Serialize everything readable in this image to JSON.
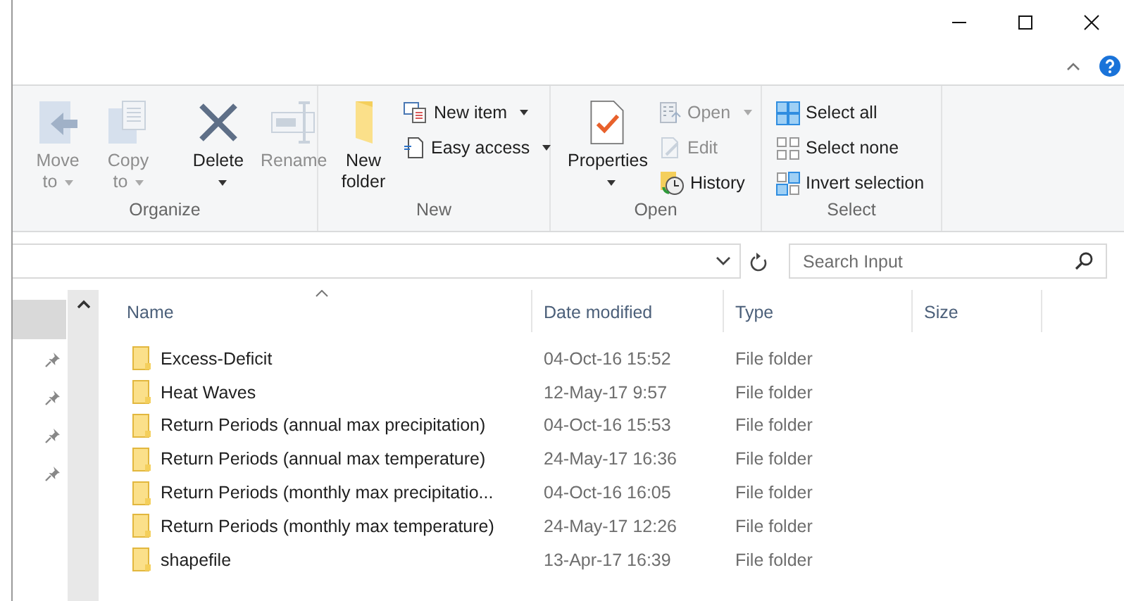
{
  "ribbon": {
    "groups": [
      {
        "label": "Organize",
        "items": [
          {
            "kind": "large",
            "label": "Move to",
            "disabled": true,
            "dropdown": true
          },
          {
            "kind": "large",
            "label": "Copy to",
            "disabled": true,
            "dropdown": true
          },
          {
            "kind": "large",
            "label": "Delete",
            "disabled": false,
            "dropdown": true
          },
          {
            "kind": "large",
            "label": "Rename",
            "disabled": true,
            "dropdown": false
          }
        ]
      },
      {
        "label": "New",
        "items": [
          {
            "kind": "large",
            "label": "New folder",
            "disabled": false,
            "dropdown": false
          },
          {
            "kind": "small",
            "label": "New item",
            "disabled": false,
            "dropdown": true
          },
          {
            "kind": "small",
            "label": "Easy access",
            "disabled": false,
            "dropdown": true
          }
        ]
      },
      {
        "label": "Open",
        "items": [
          {
            "kind": "large",
            "label": "Properties",
            "disabled": false,
            "dropdown": true
          },
          {
            "kind": "small",
            "label": "Open",
            "disabled": true,
            "dropdown": true
          },
          {
            "kind": "small",
            "label": "Edit",
            "disabled": true,
            "dropdown": false
          },
          {
            "kind": "small",
            "label": "History",
            "disabled": false,
            "dropdown": false
          }
        ]
      },
      {
        "label": "Select",
        "items": [
          {
            "kind": "small",
            "label": "Select all",
            "disabled": false,
            "dropdown": false
          },
          {
            "kind": "small",
            "label": "Select none",
            "disabled": false,
            "dropdown": false
          },
          {
            "kind": "small",
            "label": "Invert selection",
            "disabled": false,
            "dropdown": false
          }
        ]
      }
    ]
  },
  "search": {
    "placeholder": "Search Input"
  },
  "nav_pane": {
    "items": [
      {
        "selected": true,
        "pinned": false
      },
      {
        "selected": false,
        "pinned": true
      },
      {
        "selected": false,
        "pinned": true
      },
      {
        "selected": false,
        "pinned": true
      },
      {
        "selected": false,
        "pinned": true
      }
    ]
  },
  "table": {
    "columns": [
      {
        "label": "Name",
        "sorted": true
      },
      {
        "label": "Date modified",
        "sorted": false
      },
      {
        "label": "Type",
        "sorted": false
      },
      {
        "label": "Size",
        "sorted": false
      }
    ],
    "rows": [
      {
        "name": "Excess-Deficit",
        "date": "04-Oct-16 15:52",
        "type": "File folder"
      },
      {
        "name": "Heat Waves",
        "date": "12-May-17 9:57",
        "type": "File folder"
      },
      {
        "name": "Return Periods (annual max precipitation)",
        "date": "04-Oct-16 15:53",
        "type": "File folder"
      },
      {
        "name": "Return Periods (annual max temperature)",
        "date": "24-May-17 16:36",
        "type": "File folder"
      },
      {
        "name": "Return Periods (monthly max precipitatio...",
        "date": "04-Oct-16 16:05",
        "type": "File folder"
      },
      {
        "name": "Return Periods (monthly max temperature)",
        "date": "24-May-17 12:26",
        "type": "File folder"
      },
      {
        "name": "shapefile",
        "date": "13-Apr-17 16:39",
        "type": "File folder"
      }
    ]
  }
}
